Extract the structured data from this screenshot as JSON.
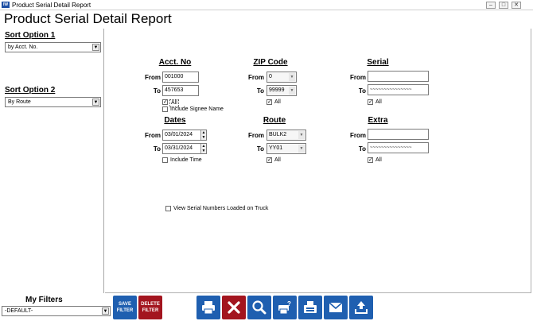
{
  "window": {
    "title": "Product Serial Detail Report"
  },
  "report_title": "Product Serial Detail Report",
  "sort": {
    "option1_label": "Sort Option 1",
    "option1_value": "by Acct. No.",
    "option2_label": "Sort Option 2",
    "option2_value": "By Route"
  },
  "acct": {
    "heading": "Acct. No",
    "from_label": "From",
    "from_value": "001000",
    "to_label": "To",
    "to_value": "457653",
    "all_label": "All",
    "signee_label": "Include Signee Name"
  },
  "zip": {
    "heading": "ZIP Code",
    "from_label": "From",
    "from_value": "0",
    "to_label": "To",
    "to_value": "99999",
    "all_label": "All"
  },
  "serial": {
    "heading": "Serial",
    "from_label": "From",
    "from_value": "",
    "to_label": "To",
    "to_value": "~~~~~~~~~~~~~~~",
    "all_label": "All"
  },
  "dates": {
    "heading": "Dates",
    "from_label": "From",
    "from_value": "03/01/2024",
    "to_label": "To",
    "to_value": "03/31/2024",
    "time_label": "Include Time"
  },
  "route": {
    "heading": "Route",
    "from_label": "From",
    "from_value": "BULK2",
    "to_label": "To",
    "to_value": "YY01",
    "all_label": "All"
  },
  "extra": {
    "heading": "Extra",
    "from_label": "From",
    "from_value": "",
    "to_label": "To",
    "to_value": "~~~~~~~~~~~~~~~",
    "all_label": "All"
  },
  "truck_label": "View Serial Numbers Loaded on Truck",
  "filters": {
    "label": "My Filters",
    "value": "-DEFAULT-",
    "save_line1": "SAVE",
    "save_line2": "FILTER",
    "delete_line1": "DELETE",
    "delete_line2": "FILTER"
  },
  "colors": {
    "accent_blue": "#1f5fb0",
    "delete_red": "#a3151f"
  },
  "icons": [
    "print-icon",
    "close-x-icon",
    "search-icon",
    "print-preview-icon",
    "fax-icon",
    "email-icon",
    "export-icon"
  ]
}
